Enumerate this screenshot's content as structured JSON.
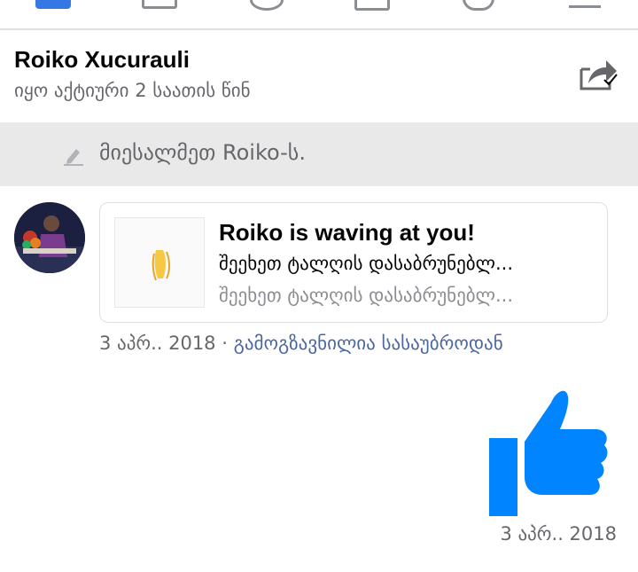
{
  "nav": {
    "icons": [
      "home-icon",
      "friends-icon",
      "messages-icon",
      "watch-icon",
      "notifications-icon",
      "menu-icon"
    ],
    "accent_color": "#3578e5"
  },
  "header": {
    "name": "Roiko Xucurauli",
    "status": "იყო აქტიური 2 საათის წინ",
    "share_icon": "share-icon"
  },
  "wave_bar": {
    "text": "მიესალმეთ Roiko-ს.",
    "icon": "pencil-icon"
  },
  "message": {
    "avatar_icon": "avatar",
    "card": {
      "title": "Roiko is waving at you!",
      "line1": "შეეხეთ ტალღის დასაბრუნებლ...",
      "line2": "შეეხეთ ტალღის დასაბრუნებლ...",
      "thumb_icon": "waving-hand-icon"
    },
    "date": "3 აპრ.. 2018",
    "separator": "·",
    "sent_from": "გამოგზავნილია სასაუბროდან"
  },
  "reply": {
    "icon": "thumbs-up-icon",
    "color": "#0084ff",
    "date": "3 აპრ.. 2018"
  }
}
